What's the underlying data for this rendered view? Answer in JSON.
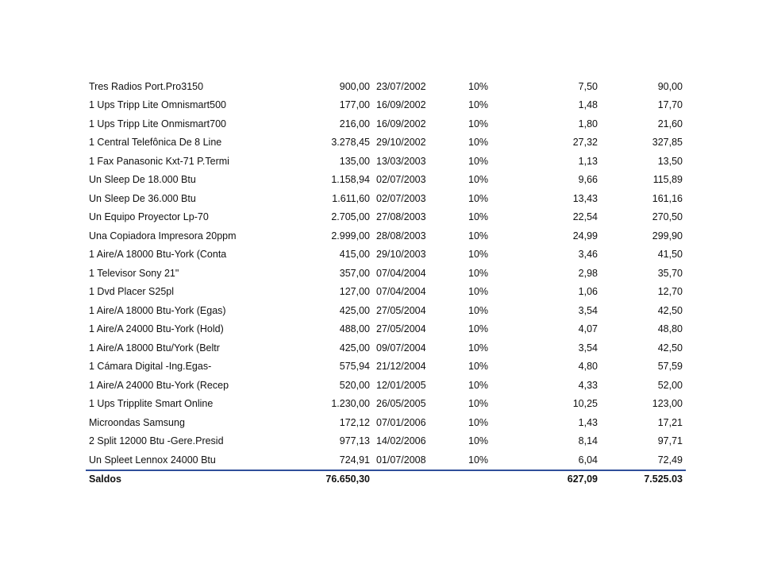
{
  "rows": [
    {
      "desc": "Tres Radios Port.Pro3150",
      "value": "900,00",
      "date": "23/07/2002",
      "rate": "10%",
      "dep": "7,50",
      "acc": "90,00"
    },
    {
      "desc": "1 Ups Tripp Lite Omnismart500",
      "value": "177,00",
      "date": "16/09/2002",
      "rate": "10%",
      "dep": "1,48",
      "acc": "17,70"
    },
    {
      "desc": "1 Ups Tripp Lite Onmismart700",
      "value": "216,00",
      "date": "16/09/2002",
      "rate": "10%",
      "dep": "1,80",
      "acc": "21,60"
    },
    {
      "desc": "1 Central Telefônica De 8 Line",
      "value": "3.278,45",
      "date": "29/10/2002",
      "rate": "10%",
      "dep": "27,32",
      "acc": "327,85"
    },
    {
      "desc": "1 Fax Panasonic Kxt-71 P.Termi",
      "value": "135,00",
      "date": "13/03/2003",
      "rate": "10%",
      "dep": "1,13",
      "acc": "13,50"
    },
    {
      "desc": "Un Sleep De 18.000 Btu",
      "value": "1.158,94",
      "date": "02/07/2003",
      "rate": "10%",
      "dep": "9,66",
      "acc": "115,89"
    },
    {
      "desc": "Un Sleep De 36.000 Btu",
      "value": "1.611,60",
      "date": "02/07/2003",
      "rate": "10%",
      "dep": "13,43",
      "acc": "161,16"
    },
    {
      "desc": "Un Equipo Proyector Lp-70",
      "value": "2.705,00",
      "date": "27/08/2003",
      "rate": "10%",
      "dep": "22,54",
      "acc": "270,50"
    },
    {
      "desc": "Una Copiadora Impresora 20ppm",
      "value": "2.999,00",
      "date": "28/08/2003",
      "rate": "10%",
      "dep": "24,99",
      "acc": "299,90"
    },
    {
      "desc": "1 Aire/A 18000 Btu-York (Conta",
      "value": "415,00",
      "date": "29/10/2003",
      "rate": "10%",
      "dep": "3,46",
      "acc": "41,50"
    },
    {
      "desc": "1 Televisor Sony 21\"",
      "value": "357,00",
      "date": "07/04/2004",
      "rate": "10%",
      "dep": "2,98",
      "acc": "35,70"
    },
    {
      "desc": "1 Dvd Placer S25pl",
      "value": "127,00",
      "date": "07/04/2004",
      "rate": "10%",
      "dep": "1,06",
      "acc": "12,70"
    },
    {
      "desc": "1 Aire/A 18000 Btu-York (Egas)",
      "value": "425,00",
      "date": "27/05/2004",
      "rate": "10%",
      "dep": "3,54",
      "acc": "42,50"
    },
    {
      "desc": "1 Aire/A 24000 Btu-York (Hold)",
      "value": "488,00",
      "date": "27/05/2004",
      "rate": "10%",
      "dep": "4,07",
      "acc": "48,80"
    },
    {
      "desc": "1 Aire/A 18000 Btu/York (Beltr",
      "value": "425,00",
      "date": "09/07/2004",
      "rate": "10%",
      "dep": "3,54",
      "acc": "42,50"
    },
    {
      "desc": "1 Cámara Digital -Ing.Egas-",
      "value": "575,94",
      "date": "21/12/2004",
      "rate": "10%",
      "dep": "4,80",
      "acc": "57,59"
    },
    {
      "desc": "1 Aire/A 24000 Btu-York (Recep",
      "value": "520,00",
      "date": "12/01/2005",
      "rate": "10%",
      "dep": "4,33",
      "acc": "52,00"
    },
    {
      "desc": "1 Ups Tripplite Smart Online",
      "value": "1.230,00",
      "date": "26/05/2005",
      "rate": "10%",
      "dep": "10,25",
      "acc": "123,00"
    },
    {
      "desc": "Microondas Samsung",
      "value": "172,12",
      "date": "07/01/2006",
      "rate": "10%",
      "dep": "1,43",
      "acc": "17,21"
    },
    {
      "desc": "2 Split 12000 Btu -Gere.Presid",
      "value": "977,13",
      "date": "14/02/2006",
      "rate": "10%",
      "dep": "8,14",
      "acc": "97,71"
    },
    {
      "desc": "Un Spleet Lennox 24000 Btu",
      "value": "724,91",
      "date": "01/07/2008",
      "rate": "10%",
      "dep": "6,04",
      "acc": "72,49"
    }
  ],
  "totals": {
    "label": "Saldos",
    "value": "76.650,30",
    "dep": "627,09",
    "acc": "7.525.03"
  },
  "colors": {
    "total_rule": "#2f4f9a"
  }
}
